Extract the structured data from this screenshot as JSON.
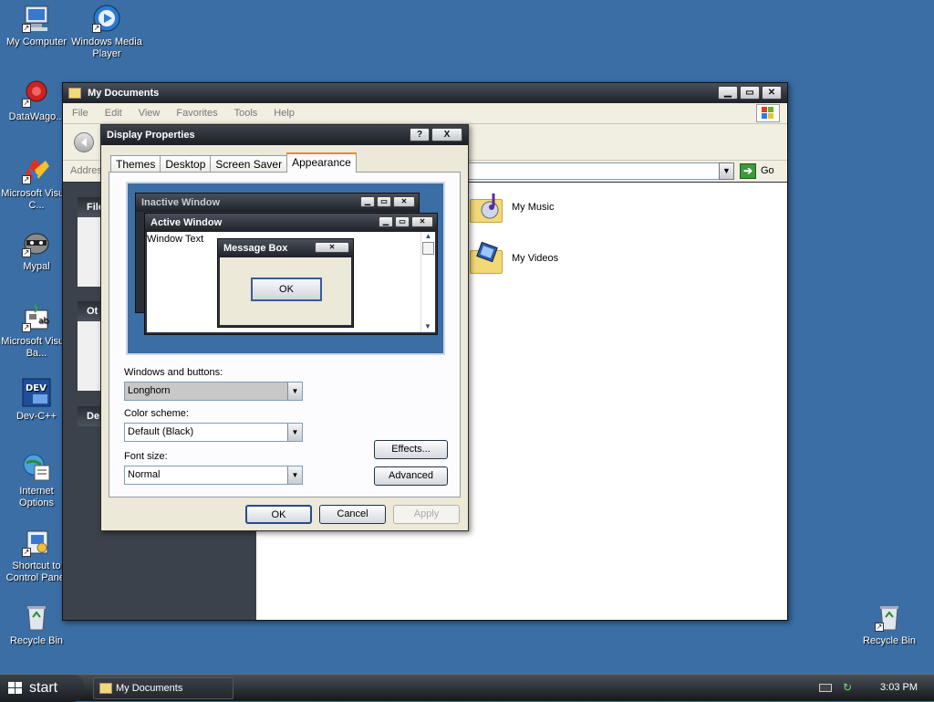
{
  "desktop": {
    "icons": [
      {
        "label": "My Computer"
      },
      {
        "label": "Windows Media Player"
      },
      {
        "label": "DataWago..."
      },
      {
        "label": "Microsoft Visual C..."
      },
      {
        "label": "Mypal"
      },
      {
        "label": "Microsoft Visual Ba..."
      },
      {
        "label": "Dev-C++",
        "glyph_text": "DEV"
      },
      {
        "label": "Internet Options"
      },
      {
        "label": "Shortcut to Control Panel"
      },
      {
        "label": "Recycle Bin"
      },
      {
        "label": "Recycle Bin"
      }
    ]
  },
  "mydocs": {
    "title": "My Documents",
    "menu": [
      "File",
      "Edit",
      "View",
      "Favorites",
      "Tools",
      "Help"
    ],
    "address_label": "Address",
    "go_label": "Go",
    "taskpane": [
      {
        "heading": "File"
      },
      {
        "heading": "Ot"
      },
      {
        "heading": "De"
      }
    ],
    "folders": [
      {
        "label": "My Music"
      },
      {
        "label": "My Videos"
      }
    ]
  },
  "display_properties": {
    "title": "Display Properties",
    "help_btn": "?",
    "close_btn": "X",
    "tabs": [
      "Themes",
      "Desktop",
      "Screen Saver",
      "Appearance"
    ],
    "active_tab": "Appearance",
    "preview": {
      "inactive_title": "Inactive Window",
      "active_title": "Active Window",
      "window_text": "Window Text",
      "message_box_title": "Message Box",
      "ok": "OK"
    },
    "windows_buttons_label": "Windows and buttons:",
    "windows_buttons_value": "Longhorn",
    "color_scheme_label": "Color scheme:",
    "color_scheme_value": "Default (Black)",
    "font_size_label": "Font size:",
    "font_size_value": "Normal",
    "effects_btn": "Effects...",
    "advanced_btn": "Advanced",
    "ok_btn": "OK",
    "cancel_btn": "Cancel",
    "apply_btn": "Apply"
  },
  "taskbar": {
    "start_label": "start",
    "task_item": "My Documents",
    "clock": "3:03 PM"
  },
  "colors": {
    "desktop": "#3a6ea5",
    "window_frame": "#2b3038",
    "dialog_face": "#ece9d8",
    "tab_highlight": "#e68b2c"
  }
}
